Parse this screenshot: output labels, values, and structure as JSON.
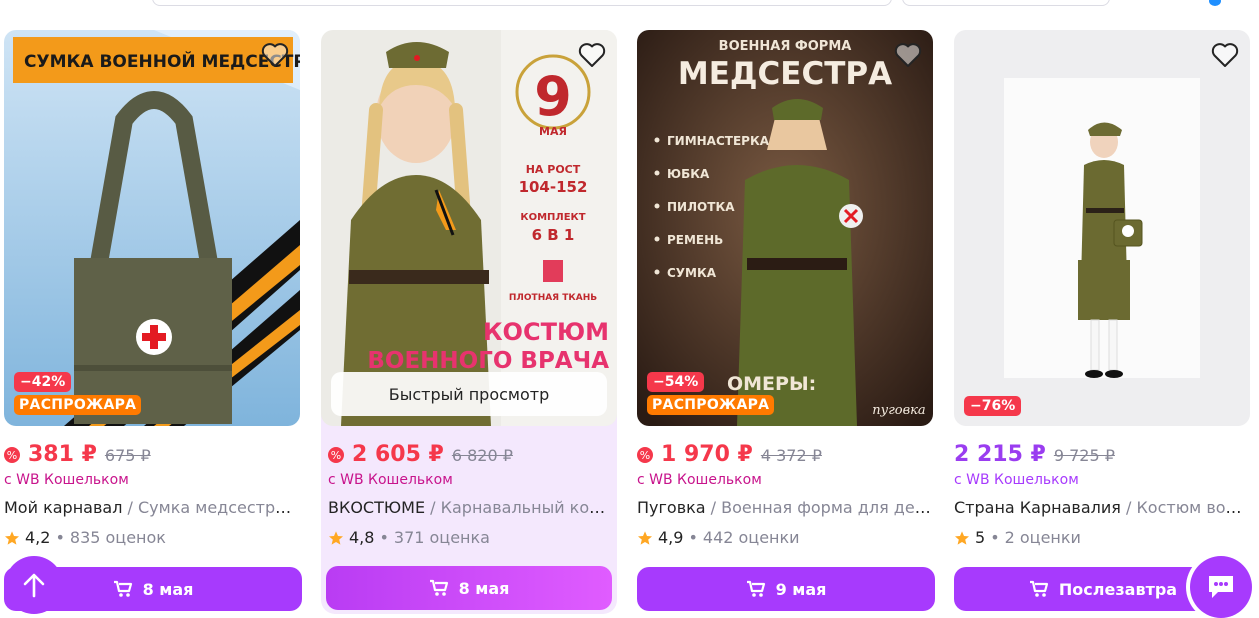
{
  "colors": {
    "accent": "#a73afd",
    "discount": "#f5384b",
    "sale": "#ff7a00",
    "wallet_pink": "#c8148c",
    "muted": "#868695"
  },
  "products": [
    {
      "image_text": "СУМКА ВОЕННОЙ МЕДСЕСТРЫ",
      "discount": "−42%",
      "sale_badge": "РАСПРОЖАРА",
      "price": "381 ₽",
      "old_price": "675 ₽",
      "wallet_note": "с WB Кошельком",
      "brand": "Мой карнавал",
      "name": "Сумка медсестры военная",
      "rating": "4,2",
      "reviews": "835 оценок",
      "delivery": "8 мая"
    },
    {
      "image_text": {
        "day": "9",
        "month": "МАЯ",
        "height_label": "НА РОСТ",
        "height_value": "104-152",
        "set_label": "КОМПЛЕКТ",
        "set_value": "6 В 1",
        "fabric": "ПЛОТНАЯ ТКАНЬ",
        "headline_1": "КОСТЮМ",
        "headline_2": "ВОЕННОГО ВРАЧА"
      },
      "quick_view": "Быстрый просмотр",
      "price": "2 605 ₽",
      "old_price": "6 820 ₽",
      "wallet_note": "с WB Кошельком",
      "brand": "ВКОСТЮМЕ",
      "name": "Карнавальный костюм",
      "rating": "4,8",
      "reviews": "371 оценка",
      "delivery": "8 мая"
    },
    {
      "image_text": {
        "top": "ВОЕННАЯ ФОРМА",
        "headline": "МЕДСЕСТРА",
        "items": [
          "ГИМНАСТЕРКА",
          "ЮБКА",
          "ПИЛОТКА",
          "РЕМЕНЬ",
          "СУМКА"
        ],
        "partial": "ОМЕРЫ:",
        "logo": "пуговка"
      },
      "discount": "−54%",
      "sale_badge": "РАСПРОЖАРА",
      "price": "1 970 ₽",
      "old_price": "4 372 ₽",
      "wallet_note": "с WB Кошельком",
      "brand": "Пуговка",
      "name": "Военная форма для девочки",
      "rating": "4,9",
      "reviews": "442 оценки",
      "delivery": "9 мая"
    },
    {
      "discount": "−76%",
      "price": "2 215 ₽",
      "old_price": "9 725 ₽",
      "wallet_note": "с WB Кошельком",
      "brand": "Страна Карнавалия",
      "name": "Костюм военной медсестры",
      "rating": "5",
      "reviews": "2 оценки",
      "delivery": "Послезавтра"
    }
  ],
  "icons": {
    "favorite": "heart-outline-icon",
    "cart": "cart-icon",
    "wallet": "wb-wallet-icon",
    "star": "star-icon",
    "scroll_up": "arrow-up-icon",
    "chat": "chat-icon"
  }
}
